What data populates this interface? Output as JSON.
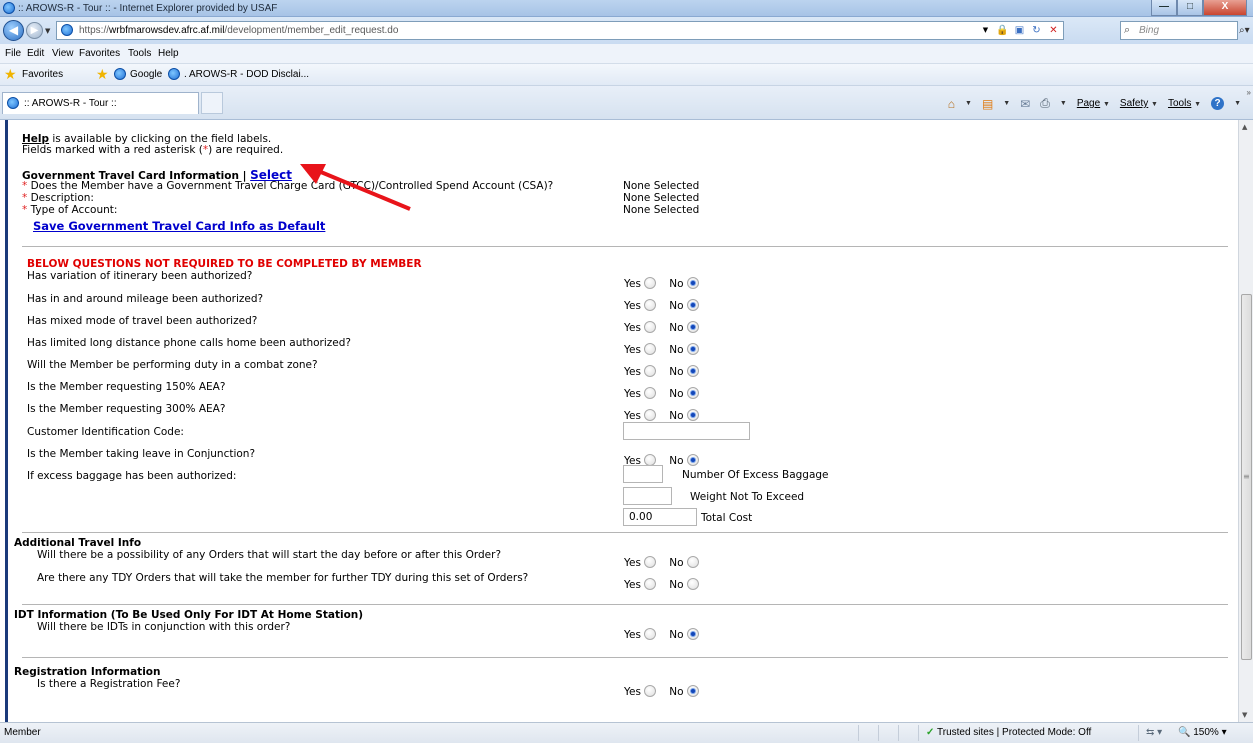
{
  "window": {
    "title": ":: AROWS-R - Tour :: - Internet Explorer provided by USAF",
    "controls": {
      "minimize": "—",
      "maximize": "□",
      "close": "X"
    }
  },
  "address_bar": {
    "url_prefix": "https://",
    "url_host": "wrbfmarowsdev.afrc.af.mil",
    "url_path": "/development/member_edit_request.do",
    "search_placeholder": "Bing"
  },
  "menu": [
    "File",
    "Edit",
    "View",
    "Favorites",
    "Tools",
    "Help"
  ],
  "favorites_bar": {
    "favorites_label": "Favorites",
    "items": [
      "Google",
      ". AROWS-R - DOD Disclai..."
    ]
  },
  "tabs": {
    "active_label": ":: AROWS-R - Tour ::"
  },
  "command_bar": {
    "page": "Page",
    "safety": "Safety",
    "tools": "Tools"
  },
  "content": {
    "help_link": "Help",
    "help_line_rest": " is available by clicking on the field labels.",
    "required_line_pre": "Fields marked with a red asterisk (",
    "required_line_star": "*",
    "required_line_post": ") are required.",
    "gtc": {
      "title": "Government Travel Card Information",
      "separator": "|",
      "select_link": "Select",
      "fields": [
        {
          "label": "Does the Member have a Government Travel Charge Card (GTCC)/Controlled Spend Account (CSA)?",
          "value": "None Selected"
        },
        {
          "label": "Description:",
          "value": "None Selected"
        },
        {
          "label": "Type of Account:",
          "value": "None Selected"
        }
      ],
      "save_default_link": "Save Government Travel Card Info as Default"
    },
    "member_questions": {
      "heading": "BELOW QUESTIONS NOT REQUIRED TO BE COMPLETED BY MEMBER",
      "questions": [
        {
          "label": "Has variation of itinerary been authorized?",
          "answer": "No"
        },
        {
          "label": "Has in and around mileage been authorized?",
          "answer": "No"
        },
        {
          "label": "Has mixed mode of travel been authorized?",
          "answer": "No"
        },
        {
          "label": "Has limited long distance phone calls home been authorized?",
          "answer": "No"
        },
        {
          "label": "Will the Member be performing duty in a combat zone?",
          "answer": "No"
        },
        {
          "label": "Is the Member requesting 150% AEA?",
          "answer": "No"
        },
        {
          "label": "Is the Member requesting 300% AEA?",
          "answer": "No"
        }
      ],
      "customer_id_label": "Customer Identification Code:",
      "customer_id_value": "",
      "leave_question": {
        "label": "Is the Member taking leave in Conjunction?",
        "answer": "No"
      },
      "baggage_label": "If excess baggage has been authorized:",
      "baggage_fields": [
        {
          "label": "Number Of Excess Baggage",
          "value": ""
        },
        {
          "label": "Weight Not To Exceed",
          "value": ""
        },
        {
          "label": "Total Cost",
          "value": "0.00"
        }
      ]
    },
    "additional_travel": {
      "title": "Additional Travel Info",
      "questions": [
        {
          "label": "Will there be a possibility of any Orders that will start the day before or after this Order?",
          "answer": ""
        },
        {
          "label": "Are there any TDY Orders that will take the member for further TDY during this set of Orders?",
          "answer": ""
        }
      ]
    },
    "idt": {
      "title": "IDT Information (To Be Used Only For IDT At Home Station)",
      "question": {
        "label": "Will there be IDTs in conjunction with this order?",
        "answer": "No"
      }
    },
    "registration": {
      "title": "Registration Information",
      "question": {
        "label": "Is there a Registration Fee?",
        "answer": "No"
      }
    },
    "radio_labels": {
      "yes": "Yes",
      "no": "No"
    }
  },
  "status_bar": {
    "left_text": "Member",
    "zone": "Trusted sites | Protected Mode: Off",
    "zoom": "150%"
  },
  "colors": {
    "required_red": "#e02020",
    "link_blue": "#0000cc",
    "frame_navy": "#1b3a7a",
    "annotation_arrow": "#e8141a"
  }
}
